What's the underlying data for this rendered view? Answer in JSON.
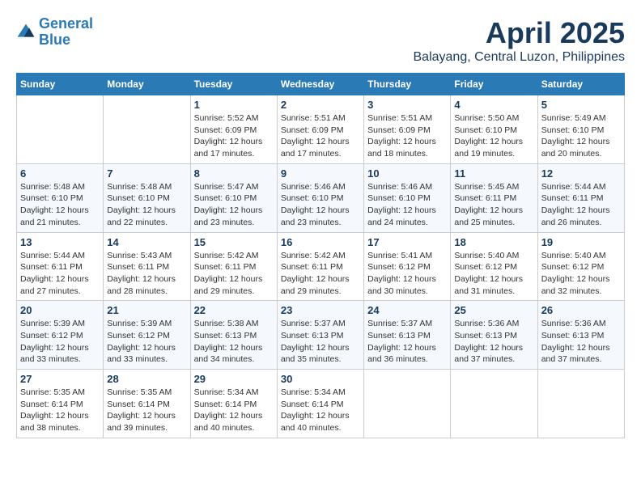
{
  "logo": {
    "line1": "General",
    "line2": "Blue"
  },
  "title": "April 2025",
  "subtitle": "Balayang, Central Luzon, Philippines",
  "weekdays": [
    "Sunday",
    "Monday",
    "Tuesday",
    "Wednesday",
    "Thursday",
    "Friday",
    "Saturday"
  ],
  "weeks": [
    [
      {
        "day": "",
        "info": ""
      },
      {
        "day": "",
        "info": ""
      },
      {
        "day": "1",
        "info": "Sunrise: 5:52 AM\nSunset: 6:09 PM\nDaylight: 12 hours and 17 minutes."
      },
      {
        "day": "2",
        "info": "Sunrise: 5:51 AM\nSunset: 6:09 PM\nDaylight: 12 hours and 17 minutes."
      },
      {
        "day": "3",
        "info": "Sunrise: 5:51 AM\nSunset: 6:09 PM\nDaylight: 12 hours and 18 minutes."
      },
      {
        "day": "4",
        "info": "Sunrise: 5:50 AM\nSunset: 6:10 PM\nDaylight: 12 hours and 19 minutes."
      },
      {
        "day": "5",
        "info": "Sunrise: 5:49 AM\nSunset: 6:10 PM\nDaylight: 12 hours and 20 minutes."
      }
    ],
    [
      {
        "day": "6",
        "info": "Sunrise: 5:48 AM\nSunset: 6:10 PM\nDaylight: 12 hours and 21 minutes."
      },
      {
        "day": "7",
        "info": "Sunrise: 5:48 AM\nSunset: 6:10 PM\nDaylight: 12 hours and 22 minutes."
      },
      {
        "day": "8",
        "info": "Sunrise: 5:47 AM\nSunset: 6:10 PM\nDaylight: 12 hours and 23 minutes."
      },
      {
        "day": "9",
        "info": "Sunrise: 5:46 AM\nSunset: 6:10 PM\nDaylight: 12 hours and 23 minutes."
      },
      {
        "day": "10",
        "info": "Sunrise: 5:46 AM\nSunset: 6:10 PM\nDaylight: 12 hours and 24 minutes."
      },
      {
        "day": "11",
        "info": "Sunrise: 5:45 AM\nSunset: 6:11 PM\nDaylight: 12 hours and 25 minutes."
      },
      {
        "day": "12",
        "info": "Sunrise: 5:44 AM\nSunset: 6:11 PM\nDaylight: 12 hours and 26 minutes."
      }
    ],
    [
      {
        "day": "13",
        "info": "Sunrise: 5:44 AM\nSunset: 6:11 PM\nDaylight: 12 hours and 27 minutes."
      },
      {
        "day": "14",
        "info": "Sunrise: 5:43 AM\nSunset: 6:11 PM\nDaylight: 12 hours and 28 minutes."
      },
      {
        "day": "15",
        "info": "Sunrise: 5:42 AM\nSunset: 6:11 PM\nDaylight: 12 hours and 29 minutes."
      },
      {
        "day": "16",
        "info": "Sunrise: 5:42 AM\nSunset: 6:11 PM\nDaylight: 12 hours and 29 minutes."
      },
      {
        "day": "17",
        "info": "Sunrise: 5:41 AM\nSunset: 6:12 PM\nDaylight: 12 hours and 30 minutes."
      },
      {
        "day": "18",
        "info": "Sunrise: 5:40 AM\nSunset: 6:12 PM\nDaylight: 12 hours and 31 minutes."
      },
      {
        "day": "19",
        "info": "Sunrise: 5:40 AM\nSunset: 6:12 PM\nDaylight: 12 hours and 32 minutes."
      }
    ],
    [
      {
        "day": "20",
        "info": "Sunrise: 5:39 AM\nSunset: 6:12 PM\nDaylight: 12 hours and 33 minutes."
      },
      {
        "day": "21",
        "info": "Sunrise: 5:39 AM\nSunset: 6:12 PM\nDaylight: 12 hours and 33 minutes."
      },
      {
        "day": "22",
        "info": "Sunrise: 5:38 AM\nSunset: 6:13 PM\nDaylight: 12 hours and 34 minutes."
      },
      {
        "day": "23",
        "info": "Sunrise: 5:37 AM\nSunset: 6:13 PM\nDaylight: 12 hours and 35 minutes."
      },
      {
        "day": "24",
        "info": "Sunrise: 5:37 AM\nSunset: 6:13 PM\nDaylight: 12 hours and 36 minutes."
      },
      {
        "day": "25",
        "info": "Sunrise: 5:36 AM\nSunset: 6:13 PM\nDaylight: 12 hours and 37 minutes."
      },
      {
        "day": "26",
        "info": "Sunrise: 5:36 AM\nSunset: 6:13 PM\nDaylight: 12 hours and 37 minutes."
      }
    ],
    [
      {
        "day": "27",
        "info": "Sunrise: 5:35 AM\nSunset: 6:14 PM\nDaylight: 12 hours and 38 minutes."
      },
      {
        "day": "28",
        "info": "Sunrise: 5:35 AM\nSunset: 6:14 PM\nDaylight: 12 hours and 39 minutes."
      },
      {
        "day": "29",
        "info": "Sunrise: 5:34 AM\nSunset: 6:14 PM\nDaylight: 12 hours and 40 minutes."
      },
      {
        "day": "30",
        "info": "Sunrise: 5:34 AM\nSunset: 6:14 PM\nDaylight: 12 hours and 40 minutes."
      },
      {
        "day": "",
        "info": ""
      },
      {
        "day": "",
        "info": ""
      },
      {
        "day": "",
        "info": ""
      }
    ]
  ]
}
